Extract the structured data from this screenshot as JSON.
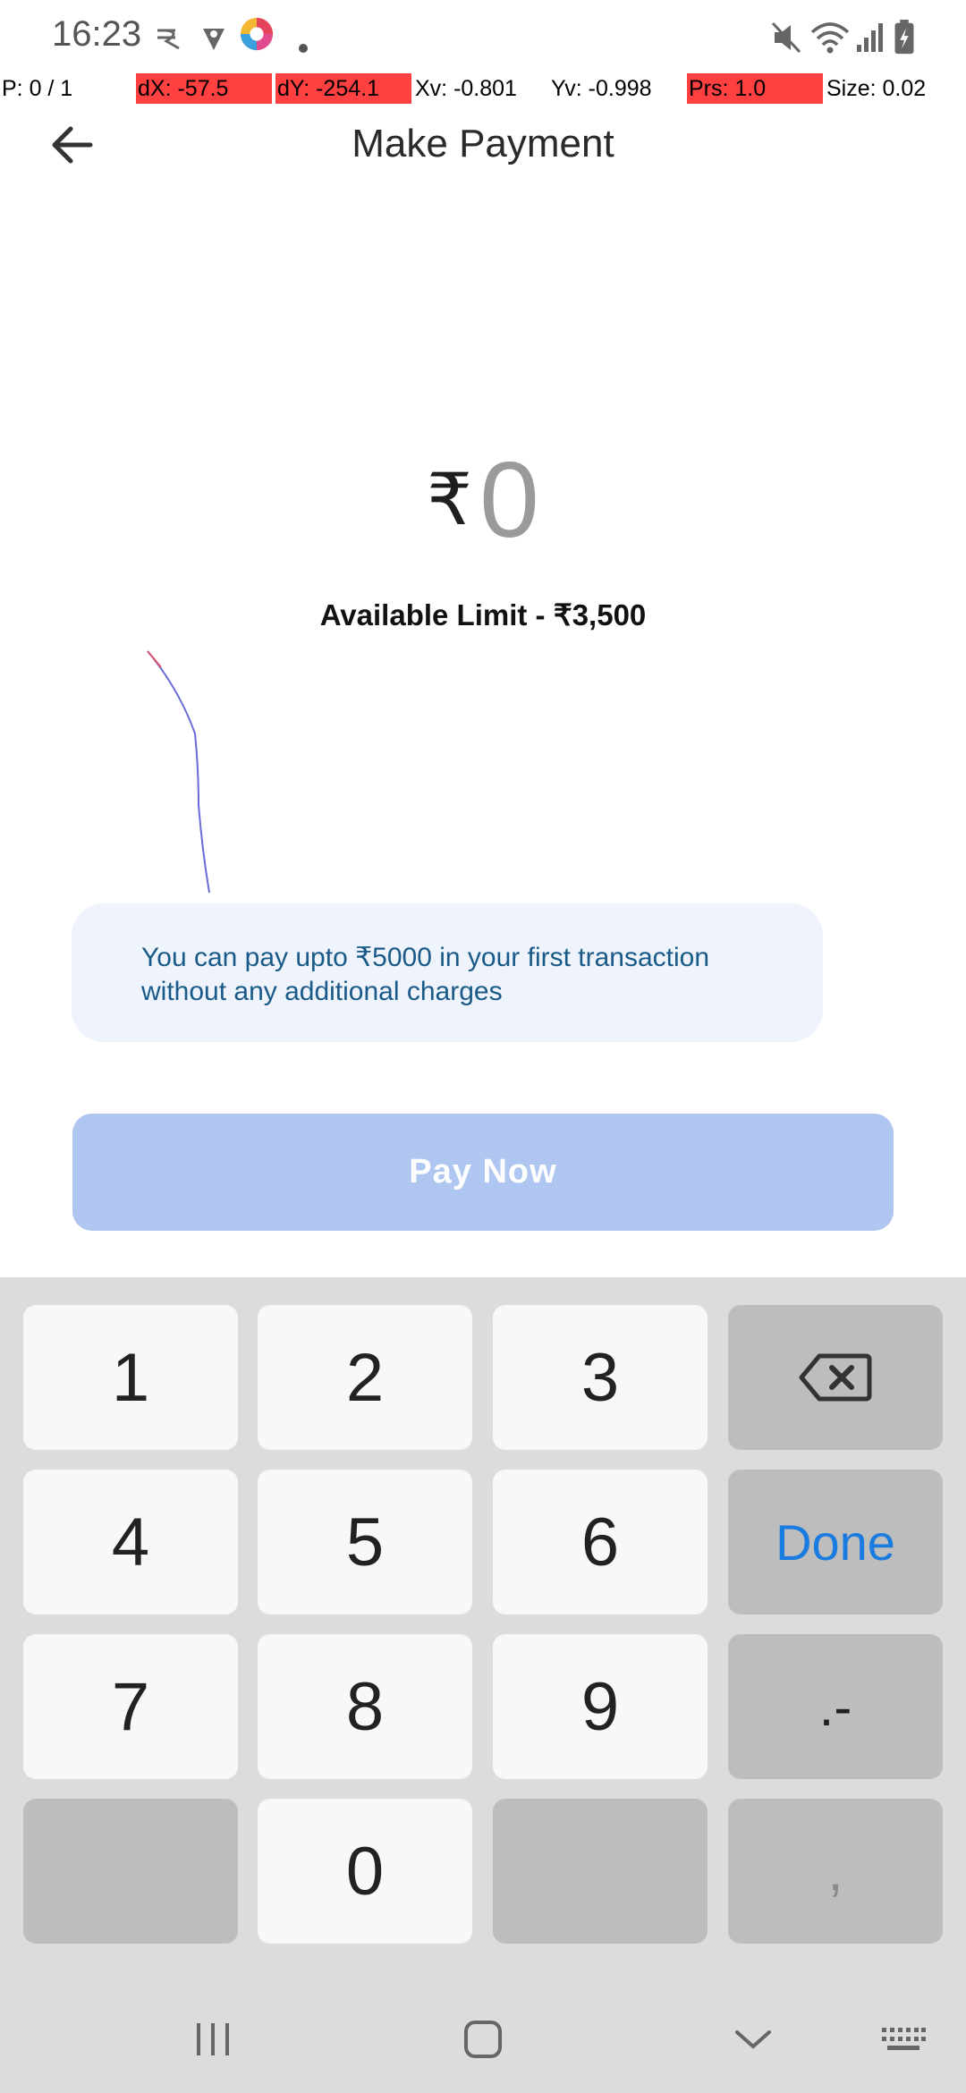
{
  "status_bar": {
    "time": "16:23",
    "icons": [
      "r-app-icon",
      "vpn-icon",
      "app-color-icon",
      "dot-icon",
      "mute-icon",
      "wifi-icon",
      "signal-icon",
      "battery-icon"
    ]
  },
  "pointer_overlay": {
    "p": "P: 0 / 1",
    "dx": "dX: -57.5",
    "dy": "dY: -254.1",
    "xv": "Xv: -0.801",
    "yv": "Yv: -0.998",
    "prs": "Prs: 1.0",
    "size": "Size: 0.02",
    "highlight_color": "#ff4040"
  },
  "header": {
    "title": "Make Payment"
  },
  "amount": {
    "currency_symbol": "₹",
    "value": "0"
  },
  "available_limit": "Available Limit - ₹3,500",
  "info": {
    "text": "You can pay upto ₹5000 in your first transaction without any additional charges"
  },
  "pay_button": {
    "label": "Pay Now",
    "state": "disabled",
    "color": "#aec6f0"
  },
  "keyboard": {
    "keys": {
      "k1": "1",
      "k2": "2",
      "k3": "3",
      "k4": "4",
      "k5": "5",
      "k6": "6",
      "k7": "7",
      "k8": "8",
      "k9": "9",
      "k0": "0",
      "done": "Done",
      "dot_dash": ".-",
      "comma": ","
    },
    "accent": "#1a7be0"
  },
  "nav_bar": {
    "icons": [
      "recents-icon",
      "home-icon",
      "back-chevron-icon",
      "keyboard-icon"
    ]
  }
}
